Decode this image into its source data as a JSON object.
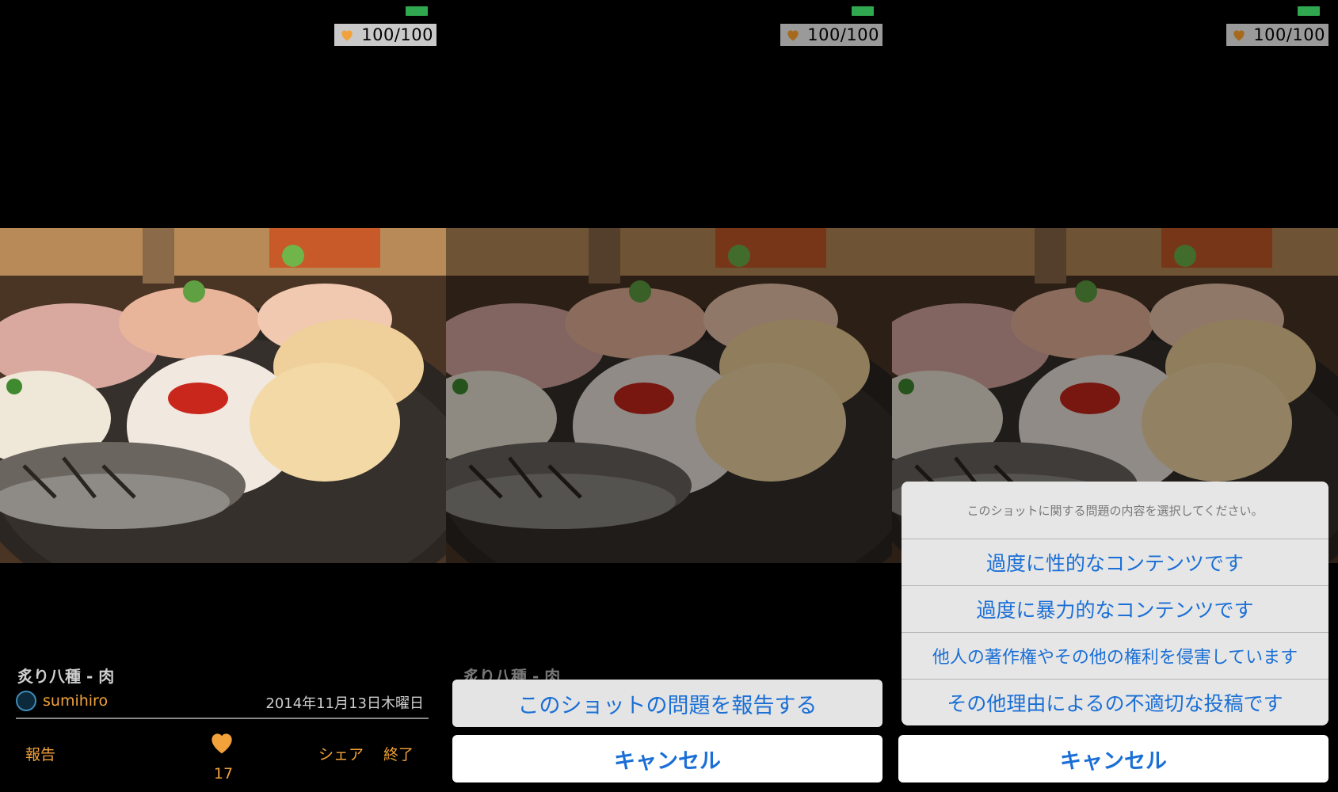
{
  "status": {
    "hearts": "100/100",
    "battery_color": "#2fa84f"
  },
  "shot": {
    "title": "炙り八種 - 肉",
    "user": "sumihiro",
    "date": "2014年11月13日木曜日",
    "likes": "17"
  },
  "actions": {
    "report": "報告",
    "share": "シェア",
    "end": "終了"
  },
  "sheet1": {
    "report_label": "このショットの問題を報告する",
    "cancel": "キャンセル"
  },
  "sheet2": {
    "prompt": "このショットに関する問題の内容を選択してください。",
    "options": [
      "過度に性的なコンテンツです",
      "過度に暴力的なコンテンツです",
      "他人の著作権やその他の権利を侵害しています",
      "その他理由によるの不適切な投稿です"
    ],
    "cancel": "キャンセル"
  },
  "colors": {
    "accent": "#f2a23a",
    "link": "#1a6fd6"
  }
}
